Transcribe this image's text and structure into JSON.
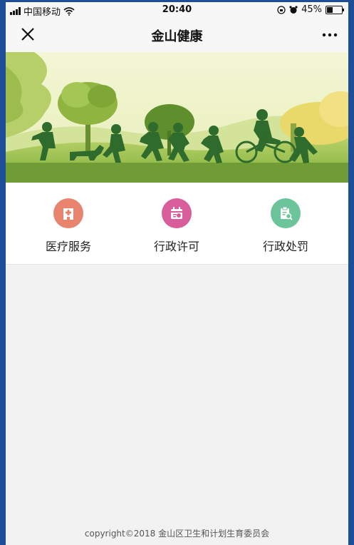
{
  "status_bar": {
    "carrier": "中国移动",
    "time": "20:40",
    "battery": "45%",
    "battery_level": 0.45
  },
  "navbar": {
    "title": "金山健康",
    "close_icon": "close-icon",
    "more_icon": "more-icon"
  },
  "menu": {
    "items": [
      {
        "label": "医疗服务",
        "icon": "hospital-icon",
        "color": "#e8846d"
      },
      {
        "label": "行政许可",
        "icon": "calendar-license-icon",
        "color": "#d95d9b"
      },
      {
        "label": "行政处罚",
        "icon": "clipboard-search-icon",
        "color": "#6cc49a"
      }
    ]
  },
  "footer": {
    "copyright": "copyright©2018 金山区卫生和计划生育委员会"
  },
  "colors": {
    "frame": "#1d4e97",
    "background": "#f2f2f2",
    "banner_sky": "#eef3c9",
    "silhouette": "#2f6b2c"
  }
}
